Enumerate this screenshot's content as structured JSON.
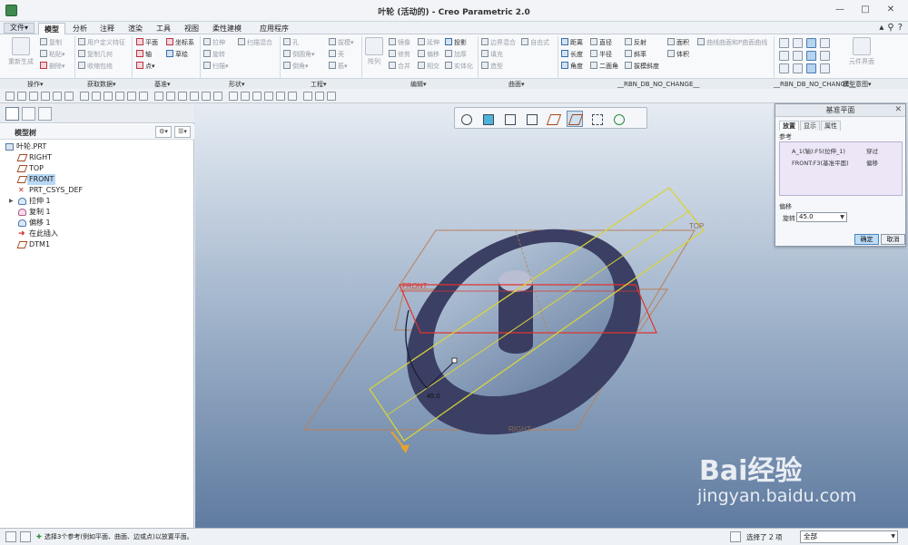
{
  "window": {
    "title": "叶轮 (活动的) - Creo Parametric 2.0",
    "buttons": [
      "—",
      "□",
      "✕"
    ]
  },
  "menubar": {
    "file": "文件▾",
    "tabs": [
      "模型",
      "分析",
      "注释",
      "渲染",
      "工具",
      "视图",
      "柔性建模",
      "应用程序"
    ],
    "active_tab": "模型"
  },
  "ribbon": {
    "groups": [
      "操作▾",
      "获取数据▾",
      "基准▾",
      "形状▾",
      "工程▾",
      "编辑▾",
      "曲面▾",
      "__RBN_DB_NO_CHANGE__",
      "__RBN_DB_NO_CHANGE__",
      "模型意图▾"
    ],
    "operations": {
      "regenerate": "重新生成",
      "copy": "复制",
      "paste": "粘贴▾",
      "delete": "删除▾"
    },
    "get_data": {
      "udf": "用户定义特征",
      "copy_geom": "复制几何",
      "shrinkwrap": "收缩包络"
    },
    "datum": {
      "plane": "平面",
      "csys": "坐标系",
      "axis": "轴",
      "sketch": "草绘",
      "point": "点▾"
    },
    "shape": {
      "extrude": "拉伸",
      "revolve": "旋转",
      "sweep": "扫描▾",
      "swept_blend": "扫描混合"
    },
    "engineering": {
      "hole": "孔",
      "round": "倒圆角▾",
      "chamfer": "倒角▾",
      "draft": "拔模▾",
      "shell": "壳",
      "rib": "筋▾"
    },
    "edit": {
      "pattern": "阵列",
      "mirror": "镜像",
      "trim": "修剪",
      "merge": "合并",
      "extend": "延伸",
      "offset": "偏移",
      "intersect": "相交",
      "project": "投影",
      "thicken": "加厚",
      "solidify": "实体化"
    },
    "surface": {
      "boundary_blend": "边界混合",
      "freestyle": "自由式",
      "fill": "填充",
      "style": "造型"
    },
    "measure": {
      "distance": "距离",
      "length": "长度",
      "angle": "角度",
      "diameter": "直径",
      "radius": "半径",
      "dihedral": "二面角",
      "reflection": "反射",
      "slope": "斜率",
      "draft_slope": "拔模斜度",
      "area": "面积",
      "volume": "体积",
      "curvature": "曲线曲面和P曲面曲线"
    },
    "component_interface": "元件界面"
  },
  "model_tree": {
    "title": "模型树",
    "items": [
      {
        "label": "叶轮.PRT",
        "type": "part"
      },
      {
        "label": "RIGHT",
        "type": "plane"
      },
      {
        "label": "TOP",
        "type": "plane"
      },
      {
        "label": "FRONT",
        "type": "plane"
      },
      {
        "label": "PRT_CSYS_DEF",
        "type": "csys"
      },
      {
        "label": "拉伸 1",
        "type": "feature"
      },
      {
        "label": "复制 1",
        "type": "feature"
      },
      {
        "label": "偏移 1",
        "type": "feature"
      },
      {
        "label": "在此插入",
        "type": "insert"
      },
      {
        "label": "DTM1",
        "type": "plane"
      }
    ]
  },
  "viewport_labels": {
    "top": "TOP",
    "front": "FRONT",
    "right": "RIGHT",
    "angle": "45.0"
  },
  "dialog": {
    "title": "基准平面",
    "tabs": [
      "放置",
      "显示",
      "属性"
    ],
    "active_tab": "放置",
    "references_label": "参考",
    "references": [
      {
        "ref": "A_1(轴):F5(拉伸_1)",
        "constraint": "穿过"
      },
      {
        "ref": "FRONT:F3(基准平面)",
        "constraint": "偏移"
      }
    ],
    "offset_label": "偏移",
    "rotation_label": "旋转",
    "rotation_value": "45.0",
    "ok": "确定",
    "cancel": "取消"
  },
  "statusbar": {
    "message": "选择3个参考(例如平面、曲面、边或点)以放置平面。",
    "selection_count": "选择了 2 项",
    "filter": "全部"
  },
  "watermark": {
    "main": "Bai经验",
    "sub": "jingyan.baidu.com"
  },
  "colors": {
    "ring": "#3b3f63",
    "plane_new": "#d8d33a",
    "plane_datum": "#b8805a",
    "front_highlight": "#e0342c"
  }
}
